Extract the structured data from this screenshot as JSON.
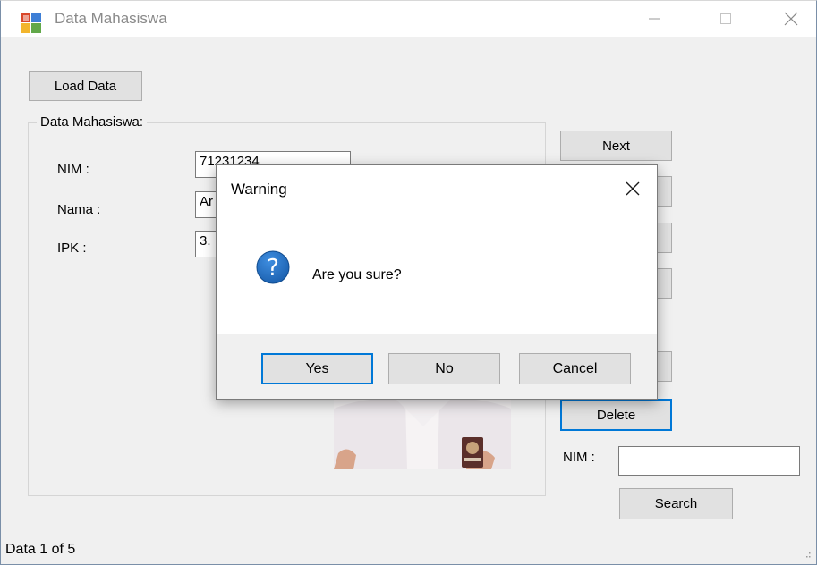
{
  "window": {
    "title": "Data Mahasiswa"
  },
  "toolbar": {
    "load_label": "Load Data"
  },
  "group": {
    "legend": "Data Mahasiswa:",
    "nim_label": "NIM :",
    "nama_label": "Nama :",
    "ipk_label": "IPK :",
    "nim_value": "71231234",
    "nama_value": "Ar",
    "ipk_value": "3."
  },
  "nav": {
    "next_label": "Next",
    "delete_label": "Delete"
  },
  "search": {
    "nim_label": "NIM :",
    "value": "",
    "button_label": "Search"
  },
  "status": {
    "text": "Data  1 of 5"
  },
  "dialog": {
    "title": "Warning",
    "message": "Are you sure?",
    "icon": "question-icon",
    "buttons": {
      "yes": "Yes",
      "no": "No",
      "cancel": "Cancel"
    }
  },
  "colors": {
    "focus": "#0078d7",
    "question_icon": "#1a67b4",
    "button": "#e1e1e1"
  }
}
